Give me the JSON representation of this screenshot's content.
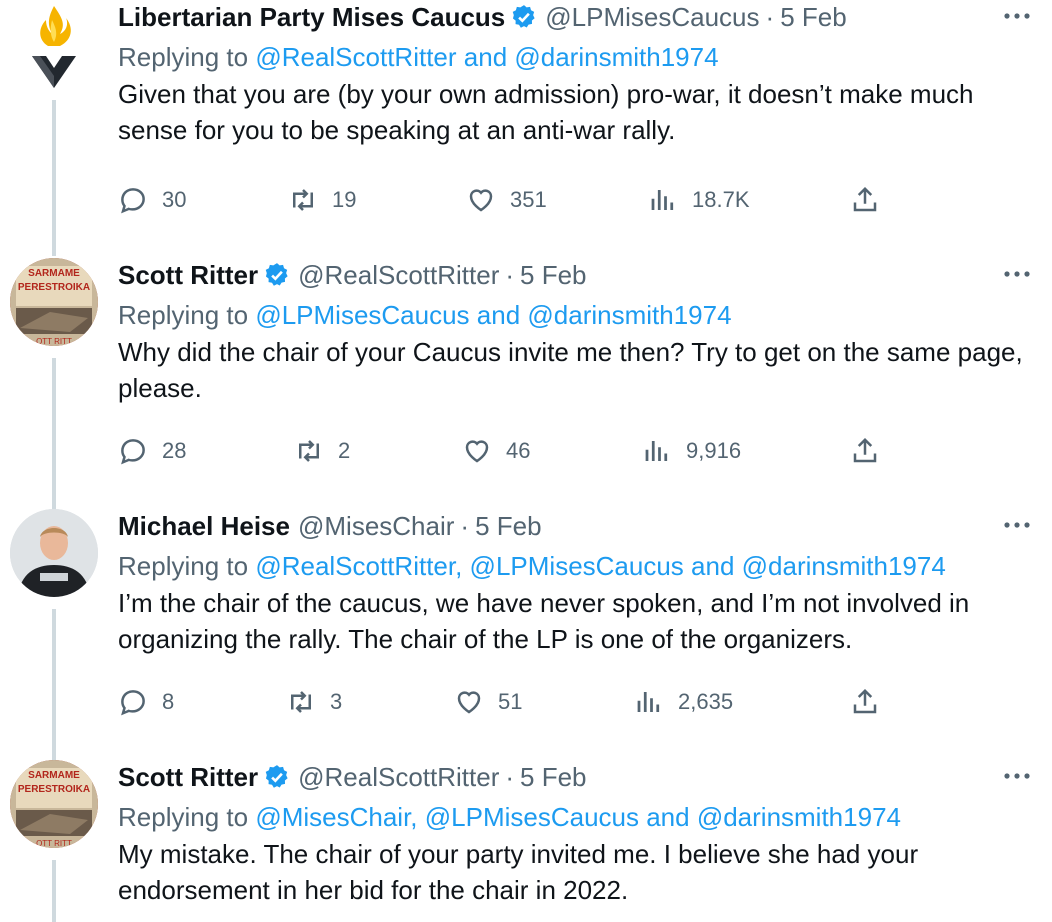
{
  "tweets": [
    {
      "name": "Libertarian Party Mises Caucus",
      "handle": "@LPMisesCaucus",
      "dot": "·",
      "date": "5 Feb",
      "reply_prefix": "Replying to",
      "reply_mentions": "@RealScottRitter and @darinsmith1974",
      "text": "Given that you are (by your own admission) pro-war, it doesn’t make much sense for you to be speaking at an anti-war rally.",
      "replies": "30",
      "retweets": "19",
      "likes": "351",
      "views": "18.7K",
      "avatar": "flame-logo"
    },
    {
      "name": "Scott Ritter",
      "handle": "@RealScottRitter",
      "dot": "·",
      "date": "5 Feb",
      "reply_prefix": "Replying to",
      "reply_mentions": "@LPMisesCaucus and @darinsmith1974",
      "text": "Why did the chair of your Caucus invite me then? Try to get on the same page, please.",
      "replies": "28",
      "retweets": "2",
      "likes": "46",
      "views": "9,916",
      "avatar": "book-cover",
      "avatar_text": [
        "SARMAME",
        "PERESTROIKA",
        "OTT RITT"
      ]
    },
    {
      "name": "Michael Heise",
      "handle": "@MisesChair",
      "dot": "·",
      "date": "5 Feb",
      "reply_prefix": "Replying to",
      "reply_mentions": "@RealScottRitter, @LPMisesCaucus and @darinsmith1974",
      "text": "I’m the chair of the caucus, we have never spoken, and I’m not involved in organizing the rally. The chair of the LP is one of the organizers.",
      "replies": "8",
      "retweets": "3",
      "likes": "51",
      "views": "2,635",
      "avatar": "person-photo"
    },
    {
      "name": "Scott Ritter",
      "handle": "@RealScottRitter",
      "dot": "·",
      "date": "5 Feb",
      "reply_prefix": "Replying to",
      "reply_mentions": "@MisesChair, @LPMisesCaucus and @darinsmith1974",
      "text": "My mistake. The chair of your party invited me. I believe she had your endorsement in her bid for the chair in 2022.",
      "avatar": "book-cover",
      "avatar_text": [
        "SARMAME",
        "PERESTROIKA",
        "OTT RITT"
      ]
    }
  ],
  "colors": {
    "link": "#1d9bf0",
    "muted": "#536471",
    "verified": "#1d9bf0",
    "thread": "#cfd9de"
  },
  "icons": [
    "reply-icon",
    "retweet-icon",
    "like-icon",
    "views-icon",
    "share-icon",
    "verified-badge-icon",
    "more-icon"
  ]
}
